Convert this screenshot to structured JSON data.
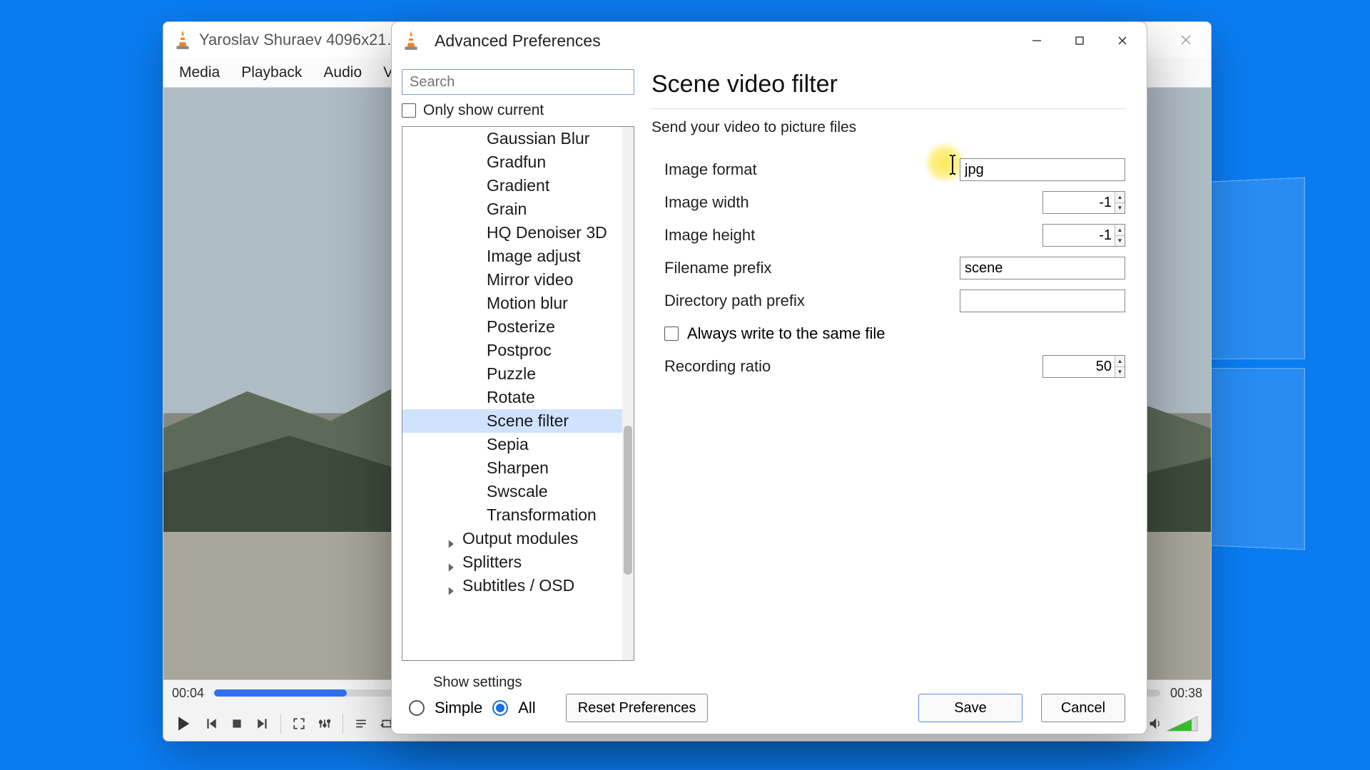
{
  "vlc": {
    "title": "Yaroslav Shuraev 4096x21…",
    "menu": [
      "Media",
      "Playback",
      "Audio",
      "Vi…"
    ],
    "time_cur": "00:04",
    "time_total": "00:38"
  },
  "prefs": {
    "title": "Advanced Preferences",
    "search_placeholder": "Search",
    "only_current": "Only show current",
    "tree": {
      "items": [
        "Gaussian Blur",
        "Gradfun",
        "Gradient",
        "Grain",
        "HQ Denoiser 3D",
        "Image adjust",
        "Mirror video",
        "Motion blur",
        "Posterize",
        "Postproc",
        "Puzzle",
        "Rotate",
        "Scene filter",
        "Sepia",
        "Sharpen",
        "Swscale",
        "Transformation"
      ],
      "selected_index": 12,
      "groups": [
        "Output modules",
        "Splitters",
        "Subtitles / OSD"
      ]
    },
    "section": {
      "title": "Scene video filter",
      "desc": "Send your video to picture files",
      "fields": {
        "image_format_label": "Image format",
        "image_format_value": "jpg",
        "image_width_label": "Image width",
        "image_width_value": "-1",
        "image_height_label": "Image height",
        "image_height_value": "-1",
        "filename_prefix_label": "Filename prefix",
        "filename_prefix_value": "scene",
        "dir_prefix_label": "Directory path prefix",
        "dir_prefix_value": "",
        "same_file_label": "Always write to the same file",
        "recording_ratio_label": "Recording ratio",
        "recording_ratio_value": "50"
      }
    },
    "footer": {
      "show_settings": "Show settings",
      "simple": "Simple",
      "all": "All",
      "reset": "Reset Preferences",
      "save": "Save",
      "cancel": "Cancel"
    }
  }
}
